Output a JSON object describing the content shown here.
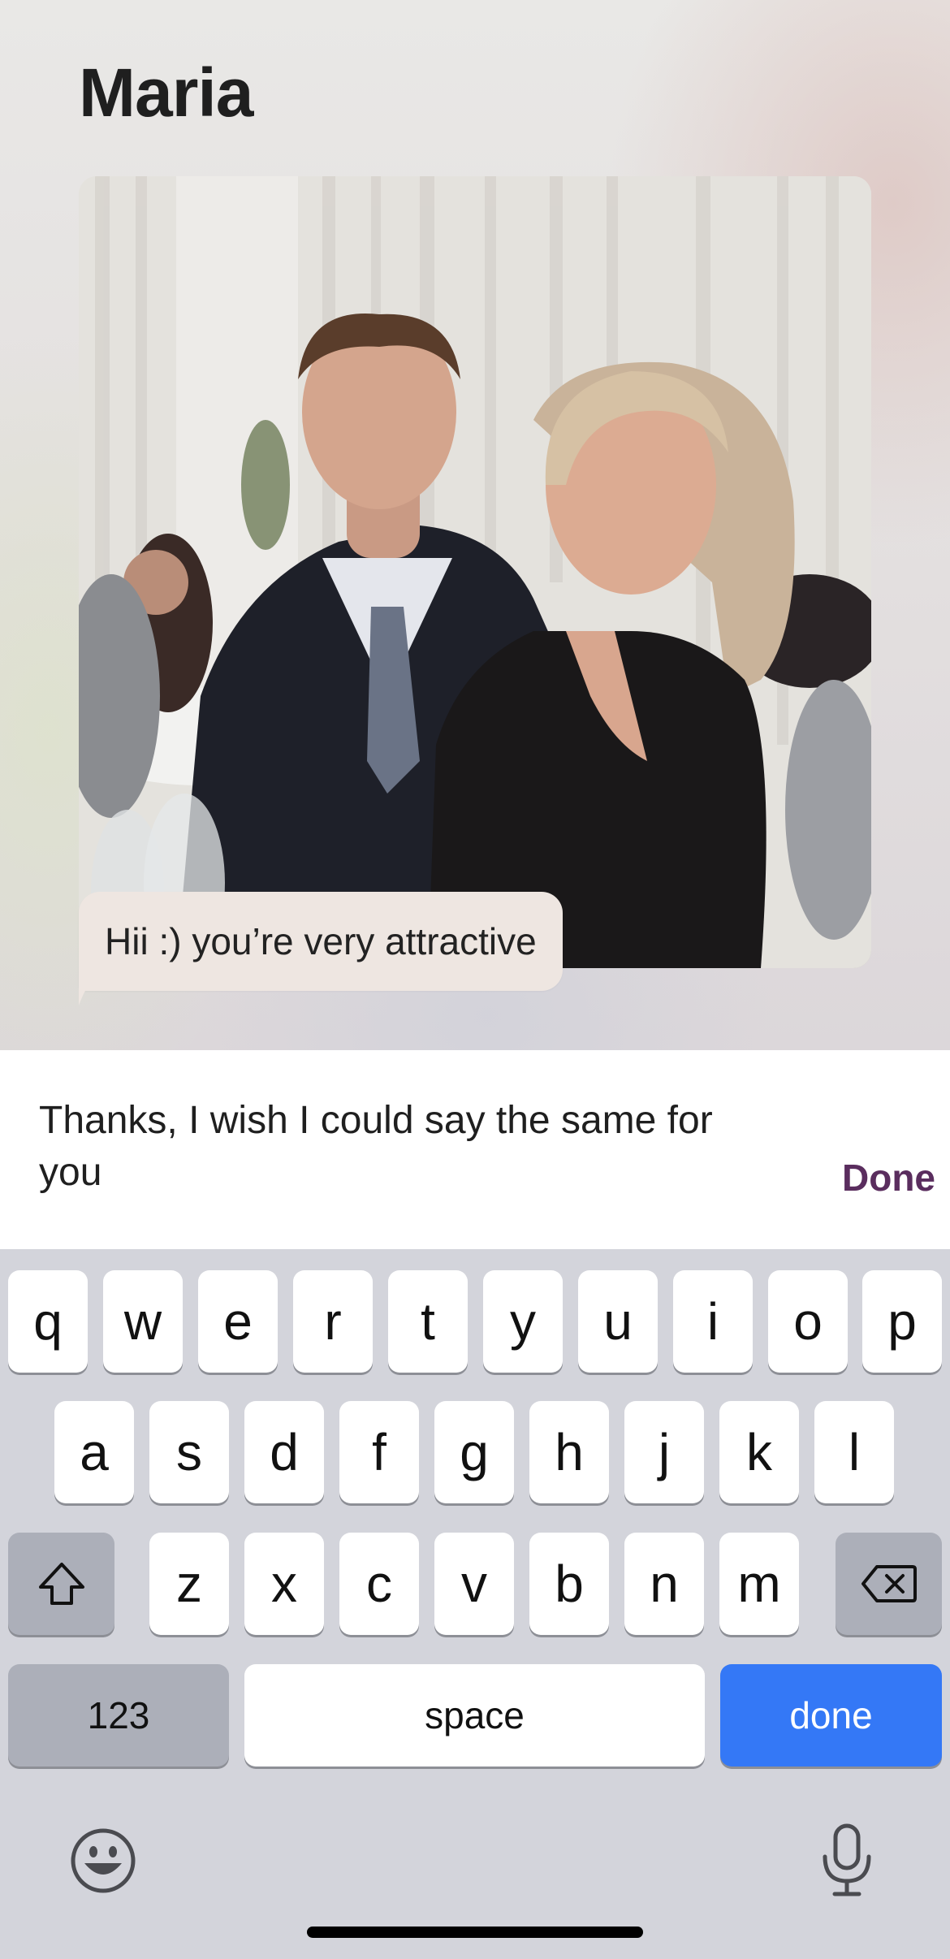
{
  "header": {
    "title": "Maria"
  },
  "message": {
    "text": "Hii :) you’re very attractive"
  },
  "compose": {
    "text": "Thanks, I wish I could say the same for you",
    "done_label": "Done"
  },
  "keyboard": {
    "row1": [
      "q",
      "w",
      "e",
      "r",
      "t",
      "y",
      "u",
      "i",
      "o",
      "p"
    ],
    "row2": [
      "a",
      "s",
      "d",
      "f",
      "g",
      "h",
      "j",
      "k",
      "l"
    ],
    "row3": [
      "z",
      "x",
      "c",
      "v",
      "b",
      "n",
      "m"
    ],
    "numbers_label": "123",
    "space_label": "space",
    "return_label": "done",
    "icons": {
      "shift": "shift-icon",
      "delete": "delete-icon",
      "emoji": "emoji-icon",
      "mic": "microphone-icon"
    }
  },
  "colors": {
    "accent": "#5a2d5e",
    "return_key": "#3478f6",
    "bubble": "#eee6e1"
  }
}
